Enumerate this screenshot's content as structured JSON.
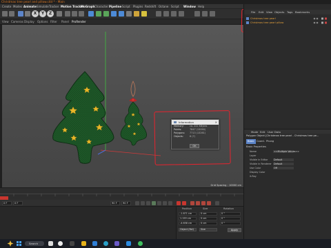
{
  "window": {
    "title": "Christmas tree pearl and pillow.c4d * - Main"
  },
  "menubar": [
    {
      "label": "Create",
      "x": 3
    },
    {
      "label": "Modes",
      "x": 16
    },
    {
      "label": "Animate",
      "x": 30
    },
    {
      "label": "Simulate",
      "x": 46
    },
    {
      "label": "Tracker",
      "x": 63
    },
    {
      "label": "Render",
      "x": 78
    },
    {
      "label": "Extensions",
      "x": 90,
      "hl": false
    },
    {
      "label": "Motion Tracker",
      "x": 88,
      "hl": true
    }
  ],
  "menubar2": [
    {
      "label": "Volume",
      "x": 0
    },
    {
      "label": "MoGraph",
      "x": 0
    },
    {
      "label": "Character",
      "x": 0
    },
    {
      "label": "Pipeline",
      "x": 0
    },
    {
      "label": "Script",
      "x": 0
    },
    {
      "label": "Plugins",
      "x": 0
    },
    {
      "label": "V-Ray Bridge",
      "x": 0
    },
    {
      "label": "Redshift",
      "x": 0
    },
    {
      "label": "Octane",
      "x": 0
    },
    {
      "label": "Script",
      "x": 0
    },
    {
      "label": "Window",
      "x": 0
    },
    {
      "label": "Help",
      "x": 0
    }
  ],
  "toolbar": {
    "axes": [
      "X",
      "Y",
      "Z"
    ]
  },
  "viewmenu": [
    "View",
    "Cameras",
    "Display",
    "Options",
    "Filter",
    "Panel",
    "ProRender"
  ],
  "viewport": {
    "grid_spacing": "Grid Spacing : 10000 cm"
  },
  "info_dialog": {
    "title": "Information",
    "rows": [
      {
        "k": "Memory:",
        "v": "ca. 222 KBytes"
      },
      {
        "k": "Points:",
        "v": "7847 (13090)"
      },
      {
        "k": "Polygons:",
        "v": "7713 (13261)"
      },
      {
        "k": "Objects:",
        "v": "6 (7)"
      }
    ],
    "ok": "OK"
  },
  "timeline": {
    "frame_start": "0 F",
    "frame_current": "0 F",
    "frame_end": "90 F",
    "frame_end2": "90 F"
  },
  "coords": {
    "headers": [
      "Position",
      "Size",
      "Rotation"
    ],
    "pos": [
      "-1.871 cm",
      "1.159 cm",
      "-4.658 cm"
    ],
    "size": [
      "0 cm",
      "0 cm",
      "0 cm"
    ],
    "rot": [
      "0 °",
      "0 °",
      "0 °"
    ],
    "mode": "Object (Rel)",
    "size_mode": "Size",
    "apply": "Apply"
  },
  "object_manager": {
    "menu": [
      "File",
      "Edit",
      "View",
      "Objects",
      "Tags",
      "Bookmarks"
    ],
    "objects": [
      {
        "name": "Christmas tree pearl"
      },
      {
        "name": "Christmas tree pearl pillow"
      }
    ]
  },
  "attributes": {
    "menu": [
      "Mode",
      "Edit",
      "User Data"
    ],
    "title": "Polygon Object [Christmas tree pearl - Christmas tree pe...",
    "tabs": [
      "Basic",
      "Coord.",
      "Phong"
    ],
    "section": "Basic Properties",
    "props": [
      {
        "label": "Name",
        "value": "<<Multiple Values>>"
      },
      {
        "label": "Layer",
        "value": ""
      },
      {
        "label": "Visible in Editor",
        "value": "Default"
      },
      {
        "label": "Visible in Renderer",
        "value": "Default"
      },
      {
        "label": "Use Color",
        "value": "Off"
      },
      {
        "label": "Display Color",
        "value": ""
      },
      {
        "label": "X-Ray",
        "value": ""
      }
    ]
  },
  "taskbar": {
    "search_placeholder": "Search"
  },
  "colors": {
    "accent": "#e07a24",
    "annotation": "#e8232e",
    "tree": "#1f5a2a",
    "star": "#e8b628",
    "selection": "#5d85c9"
  }
}
